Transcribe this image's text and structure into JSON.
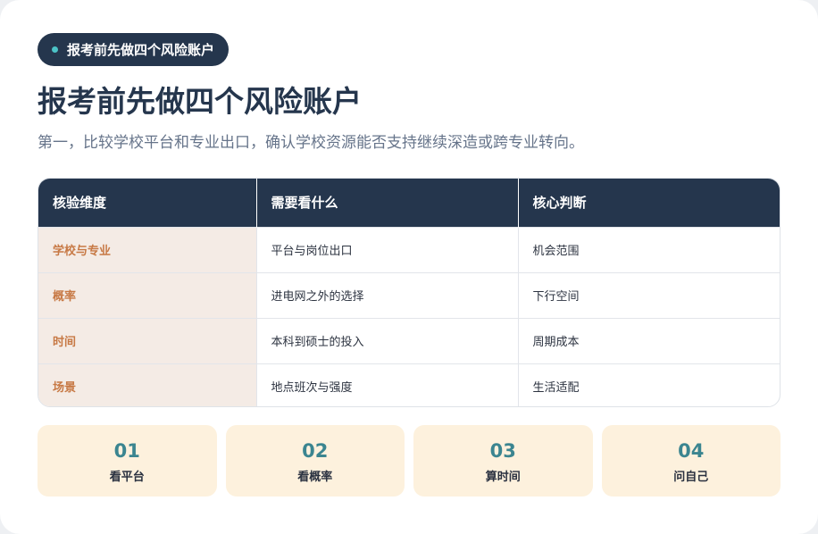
{
  "badge": {
    "label": "报考前先做四个风险账户"
  },
  "title": "报考前先做四个风险账户",
  "subtitle": "第一，比较学校平台和专业出口，确认学校资源能否支持继续深造或跨专业转向。",
  "table": {
    "headers": [
      "核验维度",
      "需要看什么",
      "核心判断"
    ],
    "rows": [
      [
        "学校与专业",
        "平台与岗位出口",
        "机会范围"
      ],
      [
        "概率",
        "进电网之外的选择",
        "下行空间"
      ],
      [
        "时间",
        "本科到硕士的投入",
        "周期成本"
      ],
      [
        "场景",
        "地点班次与强度",
        "生活适配"
      ]
    ]
  },
  "steps": [
    {
      "num": "01",
      "label": "看平台"
    },
    {
      "num": "02",
      "label": "看概率"
    },
    {
      "num": "03",
      "label": "算时间"
    },
    {
      "num": "04",
      "label": "问自己"
    }
  ],
  "colors": {
    "dark": "#25364d",
    "accent": "#3b8590",
    "dimension_text": "#c77945",
    "dimension_bg": "#f4ebe5",
    "step_bg": "#fdf1dd"
  }
}
